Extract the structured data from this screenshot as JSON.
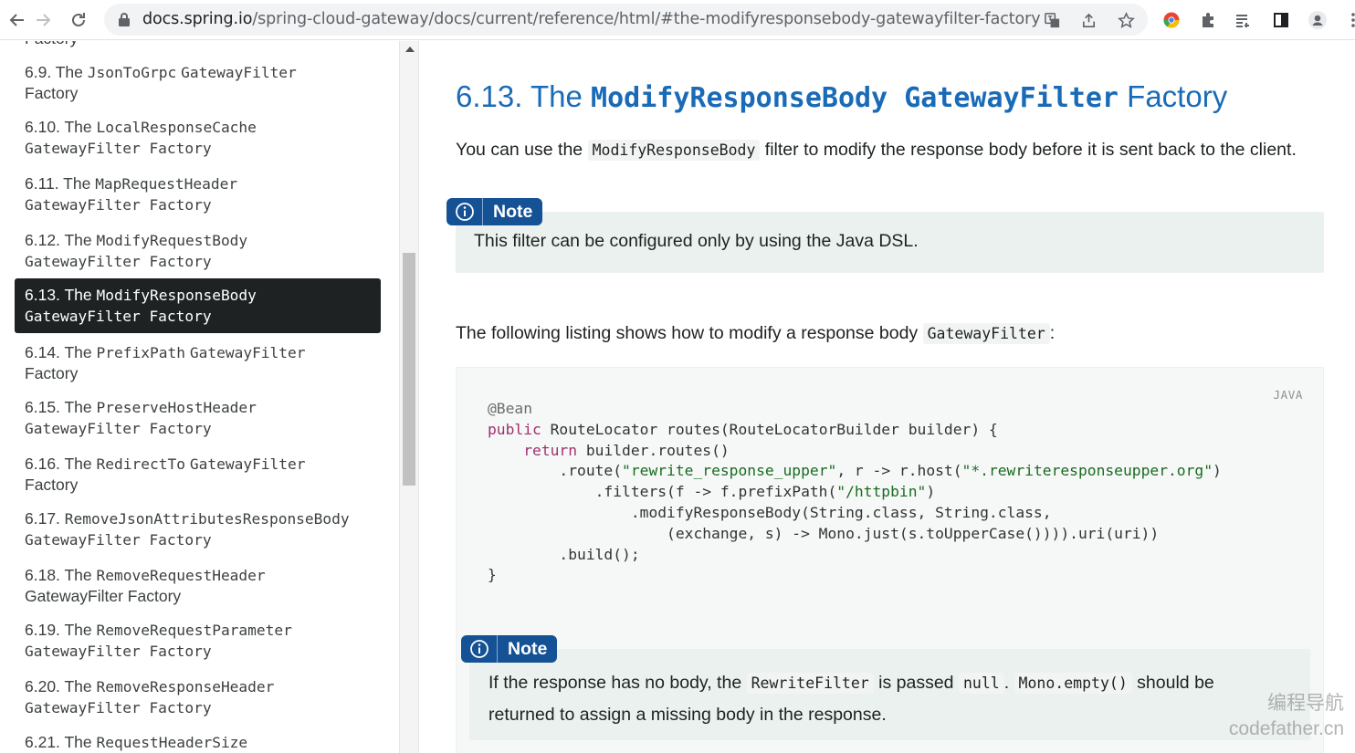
{
  "browser": {
    "url_host": "docs.spring.io",
    "url_path": "/spring-cloud-gateway/docs/current/reference/html/#the-modifyresponsebody-gatewayfilter-factory"
  },
  "sidebar": {
    "cut_item": "Factory",
    "items": [
      {
        "num": "6.9. The ",
        "code": "JsonToGrpc",
        "mid": " ",
        "code2": "GatewayFilter",
        "line2": "Factory",
        "active": false
      },
      {
        "num": "6.10. The ",
        "code": "LocalResponseCache",
        "line2": "GatewayFilter Factory",
        "active": false
      },
      {
        "num": "6.11. The ",
        "code": "MapRequestHeader",
        "line2": "GatewayFilter Factory",
        "active": false
      },
      {
        "num": "6.12. The ",
        "code": "ModifyRequestBody",
        "line2": "GatewayFilter Factory",
        "active": false
      },
      {
        "num": "6.13. The ",
        "code": "ModifyResponseBody",
        "line2": "GatewayFilter Factory",
        "active": true
      },
      {
        "num": "6.14. The ",
        "code": "PrefixPath",
        "mid": " ",
        "code2": "GatewayFilter",
        "line2": "Factory",
        "active": false
      },
      {
        "num": "6.15. The ",
        "code": "PreserveHostHeader",
        "line2": "GatewayFilter Factory",
        "active": false
      },
      {
        "num": "6.16. The ",
        "code": "RedirectTo",
        "mid": " ",
        "code2": "GatewayFilter",
        "line2": "Factory",
        "active": false
      },
      {
        "num": "6.17. ",
        "code": "RemoveJsonAttributesResponseBody",
        "line2": "GatewayFilter Factory",
        "active": false
      },
      {
        "num": "6.18. The ",
        "code": "RemoveRequestHeader",
        "line2": "GatewayFilter Factory",
        "active": false
      },
      {
        "num": "6.19. The ",
        "code": "RemoveRequestParameter",
        "line2": "GatewayFilter Factory",
        "active": false
      },
      {
        "num": "6.20. The ",
        "code": "RemoveResponseHeader",
        "line2": "GatewayFilter Factory",
        "active": false
      },
      {
        "num": "6.21. The ",
        "code": "RequestHeaderSize",
        "line2": "",
        "active": false
      }
    ]
  },
  "content": {
    "title_prefix": "6.13. The ",
    "title_code1": "ModifyResponseBody",
    "title_code2": "GatewayFilter",
    "title_suffix": " Factory",
    "intro_before": "You can use the ",
    "intro_code": "ModifyResponseBody",
    "intro_after": " filter to modify the response body before it is sent back to the client.",
    "note1_label": "Note",
    "note1_text": "This filter can be configured only by using the Java DSL.",
    "listing_before": "The following listing shows how to modify a response body ",
    "listing_code": "GatewayFilter",
    "listing_after": ":",
    "code_lang": "JAVA",
    "note2_label": "Note",
    "note2_before": "If the response has no body, the ",
    "note2_code1": "RewriteFilter",
    "note2_mid": " is passed ",
    "note2_code2": "null",
    "note2_dot": ". ",
    "note2_code3": "Mono.empty()",
    "note2_after": " should be",
    "note2_line2": "returned to assign a missing body in the response."
  },
  "code": {
    "l1": "@Bean",
    "l2_kw": "public",
    "l2_rest": " RouteLocator routes(RouteLocatorBuilder builder) {",
    "l3_indent": "    ",
    "l3_kw": "return",
    "l3_rest": " builder.routes()",
    "l4_a": "        .route(",
    "l4_str1": "\"rewrite_response_upper\"",
    "l4_b": ", r -> r.host(",
    "l4_str2": "\"*.rewriteresponseupper.org\"",
    "l4_c": ")",
    "l5_a": "            .filters(f -> f.prefixPath(",
    "l5_str": "\"/httpbin\"",
    "l5_b": ")",
    "l6": "                .modifyResponseBody(String.class, String.class,",
    "l7": "                    (exchange, s) -> Mono.just(s.toUpperCase()))).uri(uri))",
    "l8": "        .build();",
    "l9": "}"
  },
  "watermark": {
    "line1": "编程导航",
    "line2": "codefather.cn"
  },
  "colors": {
    "heading": "#1a6bb7",
    "note_tag": "#145195",
    "note_bg": "#ebf1ef",
    "active_toc": "#1e2222"
  }
}
